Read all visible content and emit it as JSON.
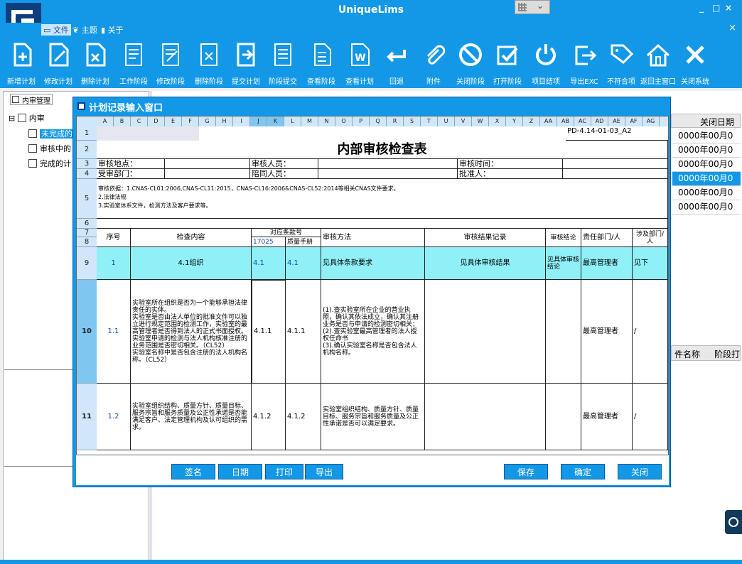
{
  "app": {
    "title": "UniqueLims"
  },
  "menu": {
    "file": "文件",
    "theme": "主题",
    "about": "关于"
  },
  "window_controls": {
    "min": "_",
    "max": "□",
    "close": "×",
    "close2": "×"
  },
  "toolbar": [
    {
      "label": "新增计划",
      "icon": "add-doc-icon"
    },
    {
      "label": "修改计划",
      "icon": "edit-doc-icon"
    },
    {
      "label": "删除计划",
      "icon": "delete-doc-icon"
    },
    {
      "label": "工作阶段",
      "icon": "stage-list-icon"
    },
    {
      "label": "修改阶段",
      "icon": "edit-stage-icon"
    },
    {
      "label": "删除阶段",
      "icon": "delete-stage-icon"
    },
    {
      "label": "提交计划",
      "icon": "submit-icon"
    },
    {
      "label": "阶段提交",
      "icon": "stage-submit-icon"
    },
    {
      "label": "查看阶段",
      "icon": "view-stage-icon"
    },
    {
      "label": "查看计划",
      "icon": "word-doc-icon"
    },
    {
      "label": "回退",
      "icon": "back-icon"
    },
    {
      "label": "附件",
      "icon": "paperclip-icon"
    },
    {
      "label": "关闭阶段",
      "icon": "ban-icon"
    },
    {
      "label": "打开阶段",
      "icon": "check-icon"
    },
    {
      "label": "项目结项",
      "icon": "power-icon"
    },
    {
      "label": "导出EXC",
      "icon": "export-icon"
    },
    {
      "label": "不符合项",
      "icon": "tag-icon"
    },
    {
      "label": "返回主窗口",
      "icon": "home-icon"
    },
    {
      "label": "关闭系统",
      "icon": "close-x-icon"
    }
  ],
  "left": {
    "tab": "内审管理",
    "tree": {
      "root": "内审",
      "items": [
        "未完成的",
        "审核中的",
        "完成的计"
      ]
    }
  },
  "right": {
    "header": "关闭日期",
    "dates": [
      "0000年00月0",
      "0000年00月0",
      "0000年00月0",
      "0000年00月0",
      "0000年00月0",
      "0000年00月0"
    ],
    "grid2_cols": [
      "件名称",
      "阶段打"
    ]
  },
  "dialog": {
    "title": "计划记录输入窗口",
    "columns": [
      "A",
      "B",
      "C",
      "D",
      "E",
      "F",
      "G",
      "H",
      "I",
      "J",
      "K",
      "L",
      "M",
      "N",
      "O",
      "P",
      "Q",
      "R",
      "S",
      "T",
      "U",
      "V",
      "W",
      "X",
      "Y",
      "Z",
      "AA",
      "AB",
      "AC",
      "AD",
      "AE",
      "AF",
      "AG"
    ],
    "rows": [
      "1",
      "2",
      "3",
      "4",
      "5",
      "6",
      "7",
      "8",
      "9",
      "10",
      "11"
    ],
    "doc_code": "PD-4.14-01-03_A2",
    "sheet_title": "内部审核检查表",
    "info": {
      "audit_location": "审核地点：",
      "auditor": "审核人员：",
      "audit_time": "审核时间：",
      "audited_dept": "受审部门：",
      "companion": "陪同人员：",
      "approver": "批准人："
    },
    "basis": [
      "审核依据：1.CNAS-CL01:2006,CNAS-CL11:2015，CNAS-CL16:2006&CNAS-CL52:2014等相关CNAS文件要求。",
      "2.法律法规",
      "3.实验室体系文件，检测方法及客户要求等。"
    ],
    "headers": {
      "seq": "序号",
      "content": "检查内容",
      "clause": "对应条款号",
      "clause_a": "17025",
      "clause_b": "质量手册",
      "method": "审核方法",
      "record": "审核结果记录",
      "conclusion": "审核结论",
      "dept": "责任部门/人",
      "involve": "涉及部门/人"
    },
    "row9": {
      "seq": "1",
      "content": "4.1组织",
      "a": "4.1",
      "b": "4.1",
      "method": "见具体条款要求",
      "record": "见具体审核结果",
      "conclusion": "见具体审核结论",
      "dept": "最高管理者",
      "involve": "见下"
    },
    "row10": {
      "seq": "1.1",
      "content": "实验室所在组织是否为一个能够承担法律责任的实体。\n实验室是否由法人单位的批准文件可以独立进行规定范围的检测工作，实验室的最高管理者是否得到法人的正式书面授权。\n实验室申请的检测与法人机构核准注册的业务范围是否密切相关。（CL52）\n实验室名称中是否包含注册的法人机构名称。（CL52）",
      "a": "4.1.1",
      "b": "4.1.1",
      "method": "(1).查实验室所在企业的营业执照，确认其依法成立，确认其注册业务是否与申请的检测密切相关；\n(2).查实验室最高管理者的法人授权任命书\n(3).确认实验室名称是否包含法人机构名称。",
      "dept": "最高管理者",
      "involve": "/"
    },
    "row11": {
      "seq": "1.2",
      "content": "实验室组织结构、质量方针、质量目标、服务宗旨和服务质量及公正性承诺是否能满足客户、法定管理机构及认可组织的需求。",
      "a": "4.1.2",
      "b": "4.1.2",
      "method": "实验室组织结构、质量方针、质量目标、服务宗旨和服务质量及公正性承诺是否可以满足要求。",
      "dept": "最高管理者",
      "involve": "/"
    },
    "buttons": {
      "sign": "签名",
      "date": "日期",
      "print": "打印",
      "export": "导出",
      "save": "保存",
      "confirm": "确定",
      "close": "关闭"
    }
  }
}
